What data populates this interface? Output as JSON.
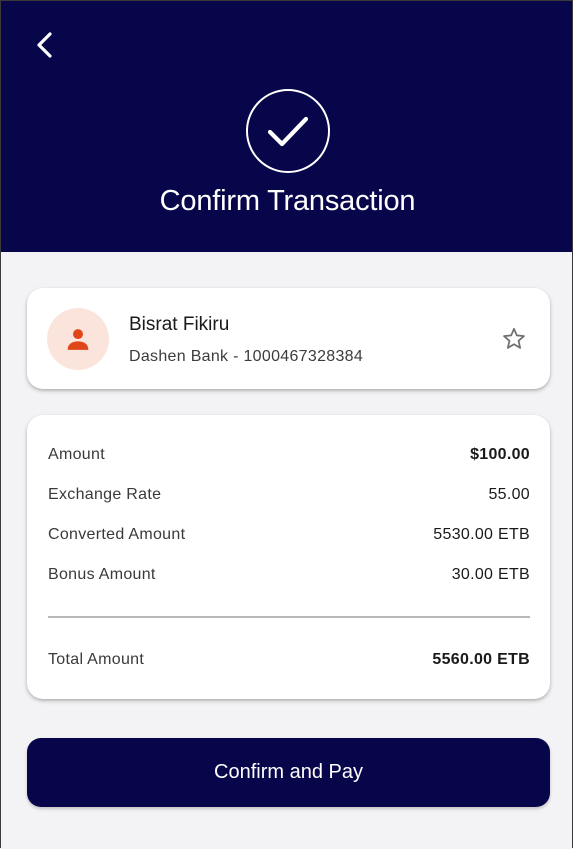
{
  "header": {
    "title": "Confirm Transaction",
    "back_icon": "chevron-left-icon",
    "status_icon": "check-circle-icon"
  },
  "recipient": {
    "name": "Bisrat Fikiru",
    "account": "Dashen Bank - 1000467328384",
    "avatar_icon": "person-icon",
    "favorite_icon": "star-outline-icon"
  },
  "summary": {
    "rows": [
      {
        "label": "Amount",
        "value": "$100.00"
      },
      {
        "label": "Exchange Rate",
        "value": "55.00"
      },
      {
        "label": "Converted Amount",
        "value": "5530.00 ETB"
      },
      {
        "label": "Bonus Amount",
        "value": "30.00 ETB"
      }
    ],
    "total": {
      "label": "Total Amount",
      "value": "5560.00 ETB"
    }
  },
  "actions": {
    "confirm_label": "Confirm and Pay"
  },
  "colors": {
    "primary": "#08064a",
    "avatar_bg": "#fbe4dc",
    "avatar_icon": "#e0461a",
    "background": "#f3f3f5"
  }
}
